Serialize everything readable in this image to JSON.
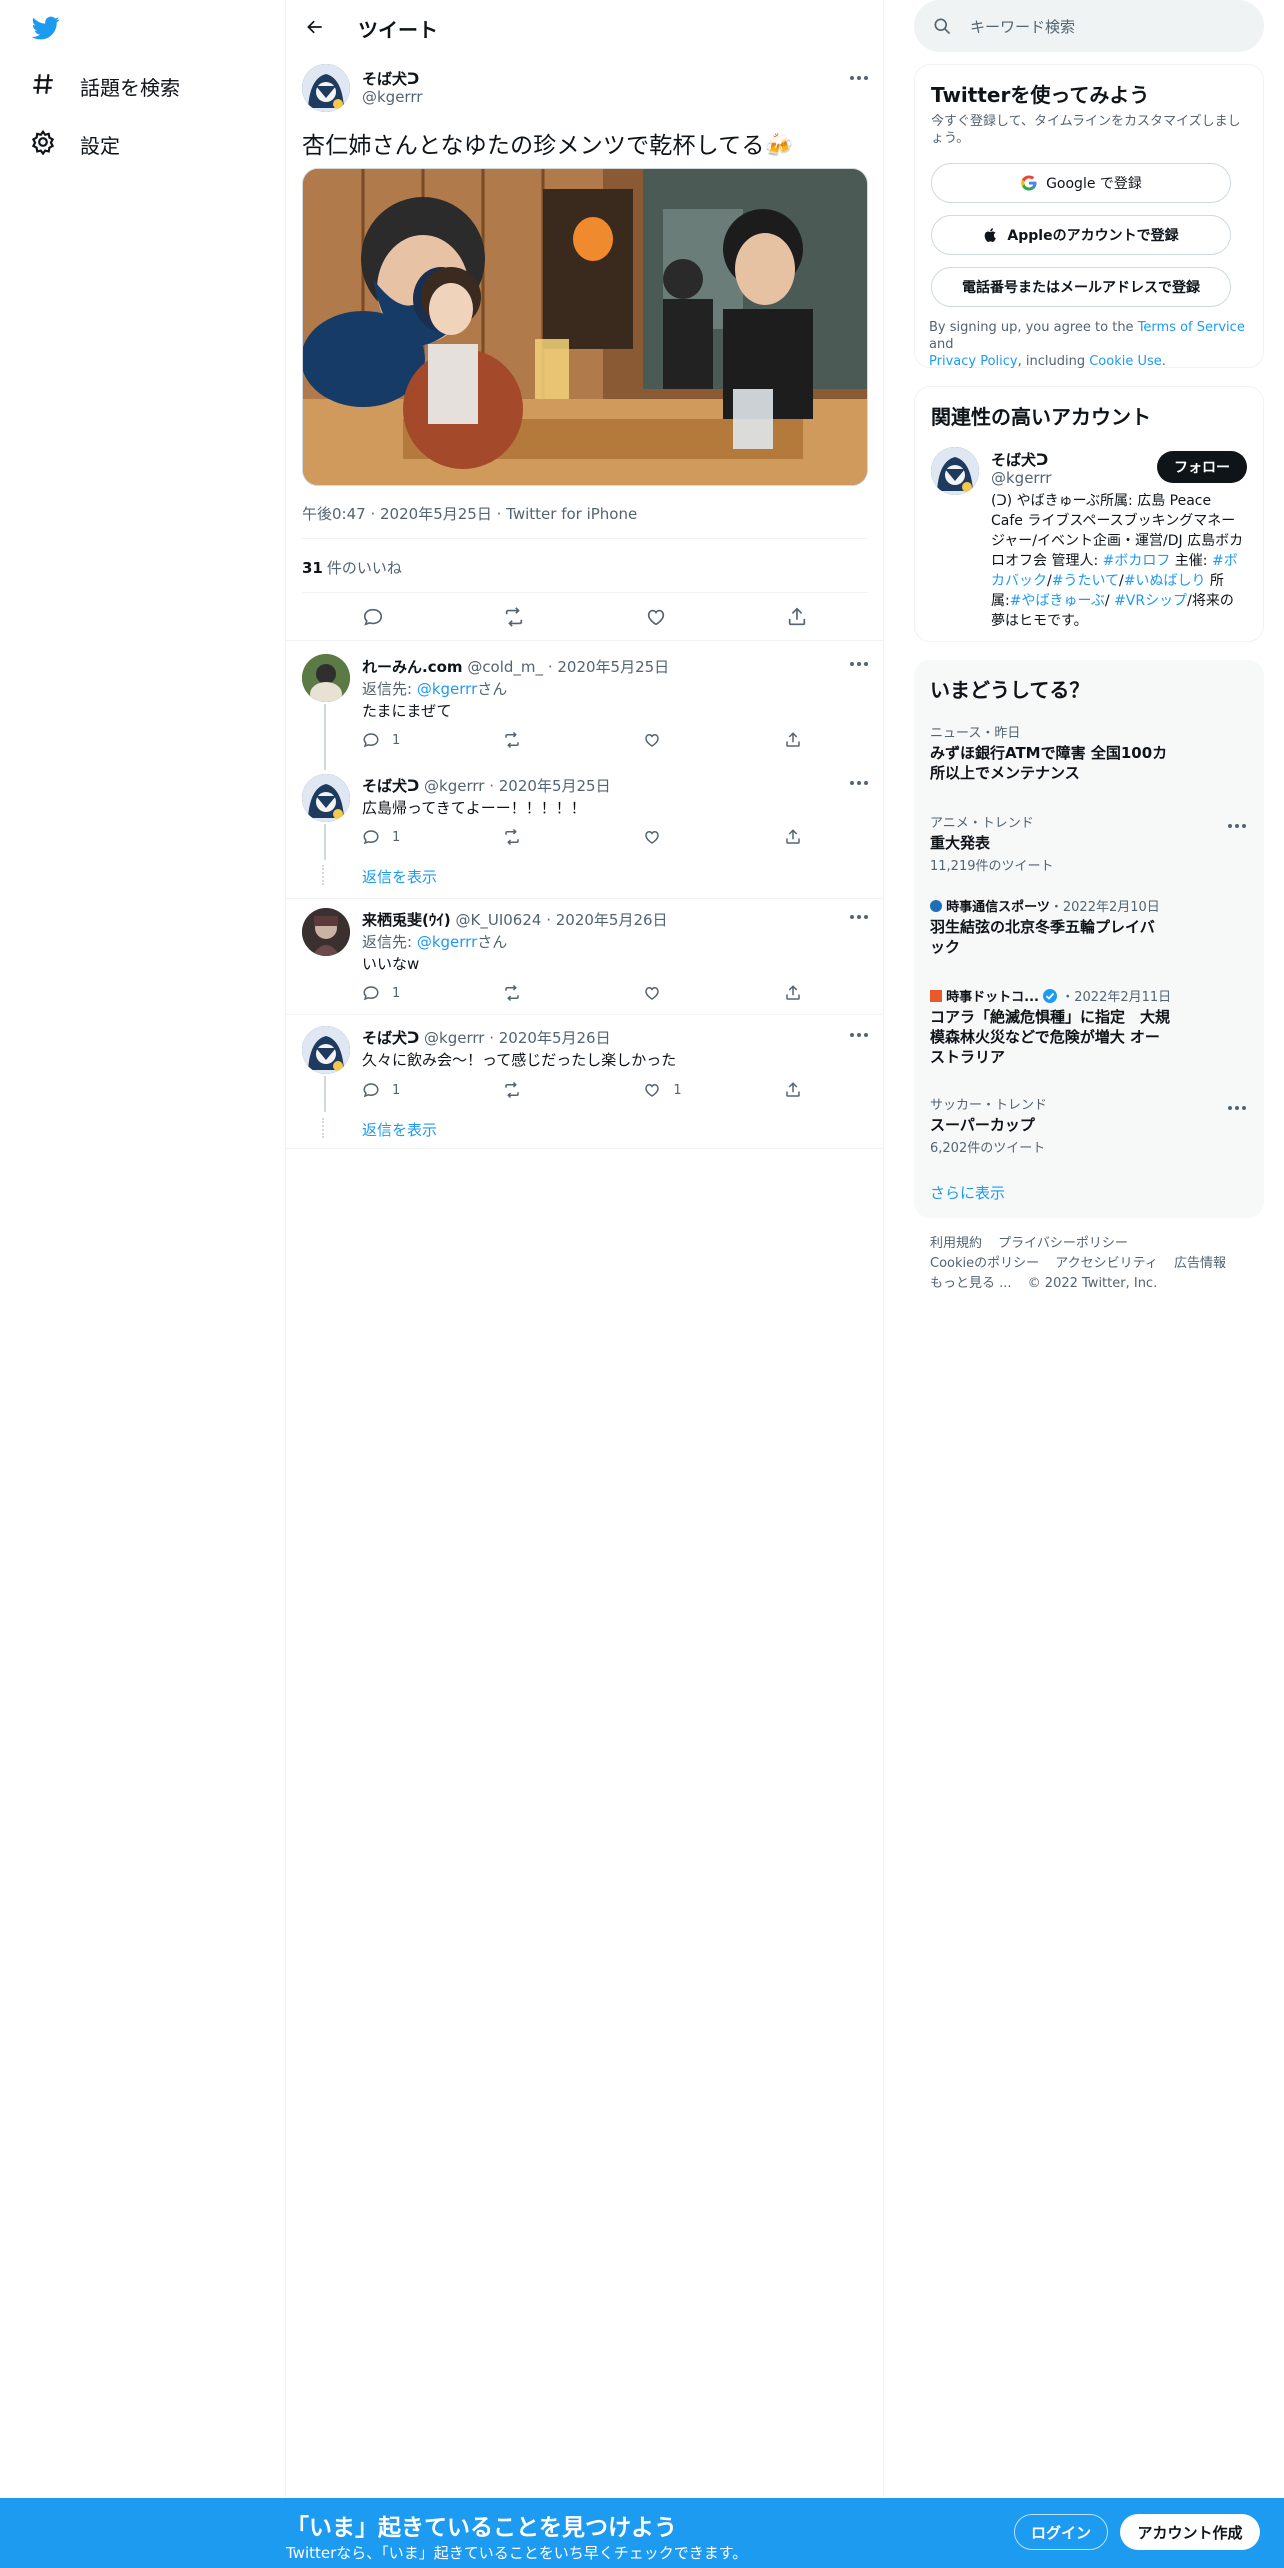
{
  "nav": {
    "explore_label": "話題を検索",
    "settings_label": "設定"
  },
  "header": {
    "title": "ツイート"
  },
  "tweet": {
    "author_name": "そば犬ᑐ",
    "author_handle": "@kgerrr",
    "text": "杏仁姉さんとなゆたの珍メンツで乾杯してる🍻",
    "time": "午後0:47",
    "date": "2020年5月25日",
    "client": "Twitter for iPhone",
    "likes_count": "31",
    "likes_label": "件のいいね"
  },
  "replies": [
    {
      "name": "れーみん.com",
      "handle": "@cold_m_",
      "date": "2020年5月25日",
      "reply_to_prefix": "返信先: ",
      "reply_to_handle": "@kgerrr",
      "reply_to_suffix": "さん",
      "text": "たまにまぜて",
      "reply_count": "1",
      "retweet_count": "",
      "like_count": ""
    },
    {
      "name": "そば犬ᑐ",
      "handle": "@kgerrr",
      "date": "2020年5月25日",
      "text": "広島帰ってきてよーー！！！！！",
      "reply_count": "1",
      "retweet_count": "",
      "like_count": "",
      "show_replies": "返信を表示"
    },
    {
      "name": "来栖兎斐(ｳｲ)",
      "handle": "@K_UI0624",
      "date": "2020年5月26日",
      "reply_to_prefix": "返信先: ",
      "reply_to_handle": "@kgerrr",
      "reply_to_suffix": "さん",
      "text": "いいなw",
      "reply_count": "1",
      "retweet_count": "",
      "like_count": ""
    },
    {
      "name": "そば犬ᑐ",
      "handle": "@kgerrr",
      "date": "2020年5月26日",
      "text": "久々に飲み会〜！って感じだったし楽しかった",
      "reply_count": "1",
      "retweet_count": "",
      "like_count": "1",
      "show_replies": "返信を表示"
    }
  ],
  "sidebar": {
    "search_placeholder": "キーワード検索",
    "signup": {
      "title": "Twitterを使ってみよう",
      "subtitle": "今すぐ登録して、タイムラインをカスタマイズしましょう。",
      "google_button": "Google で登録",
      "apple_button": "Appleのアカウントで登録",
      "phone_button": "電話番号またはメールアドレスで登録",
      "terms_prefix": "By signing up, you agree to the ",
      "terms_link": "Terms of Service",
      "terms_and": " and",
      "privacy_link": "Privacy Policy",
      "terms_including": ", including ",
      "cookie_link": "Cookie Use",
      "terms_end": "."
    },
    "related": {
      "title": "関連性の高いアカウント",
      "name": "そば犬ᑐ",
      "handle": "@kgerrr",
      "follow_label": "フォロー",
      "bio_1": "(ᑐ) やばきゅーぶ所属: 広島 Peace Cafe ライブスペースブッキングマネージャー/イベント企画・運営/DJ 広島ボカロオフ会 管理人: ",
      "bio_tag_1": "#ボカロフ",
      "bio_2": " 主催: ",
      "bio_tag_2": "#ボカバック",
      "bio_3": "/",
      "bio_tag_3": "#うたいて",
      "bio_4": "/",
      "bio_tag_4": "#いぬばしり",
      "bio_5": " 所属:",
      "bio_tag_5": "#やばきゅーぶ",
      "bio_6": "/ ",
      "bio_tag_6": "#VRシップ",
      "bio_7": "/将来の夢はヒモです。"
    },
    "trends": {
      "title": "いまどうしてる？",
      "items": [
        {
          "category": "ニュース・昨日",
          "title": "みずほ銀行ATMで障害 全国100カ所以上でメンテナンス",
          "count": ""
        },
        {
          "category": "アニメ・トレンド",
          "title": "重大発表",
          "count": "11,219件のツイート"
        },
        {
          "category": "時事通信スポーツ",
          "date": "・2022年2月10日",
          "title": "羽生結弦の北京冬季五輪プレイバック",
          "count": ""
        },
        {
          "category": "時事ドットコ...",
          "date": "・2022年2月11日",
          "title": "コアラ「絶滅危惧種」に指定　大規模森林火災などで危険が増大 オーストラリア",
          "count": ""
        },
        {
          "category": "サッカー・トレンド",
          "title": "スーパーカップ",
          "count": "6,202件のツイート"
        }
      ],
      "show_more": "さらに表示"
    },
    "footer": {
      "terms": "利用規約",
      "privacy": "プライバシーポリシー",
      "cookie": "Cookieのポリシー",
      "accessibility": "アクセシビリティ",
      "ads": "広告情報",
      "more": "もっと見る ...",
      "copyright": "© 2022 Twitter, Inc."
    }
  },
  "banner": {
    "title": "「いま」起きていることを見つけよう",
    "subtitle": "Twitterなら、「いま」起きていることをいち早くチェックできます。",
    "login": "ログイン",
    "signup": "アカウント作成"
  },
  "colors": {
    "accent": "#1d9bf0",
    "text": "#0f1419",
    "muted": "#536471",
    "border": "#eff3f4"
  }
}
